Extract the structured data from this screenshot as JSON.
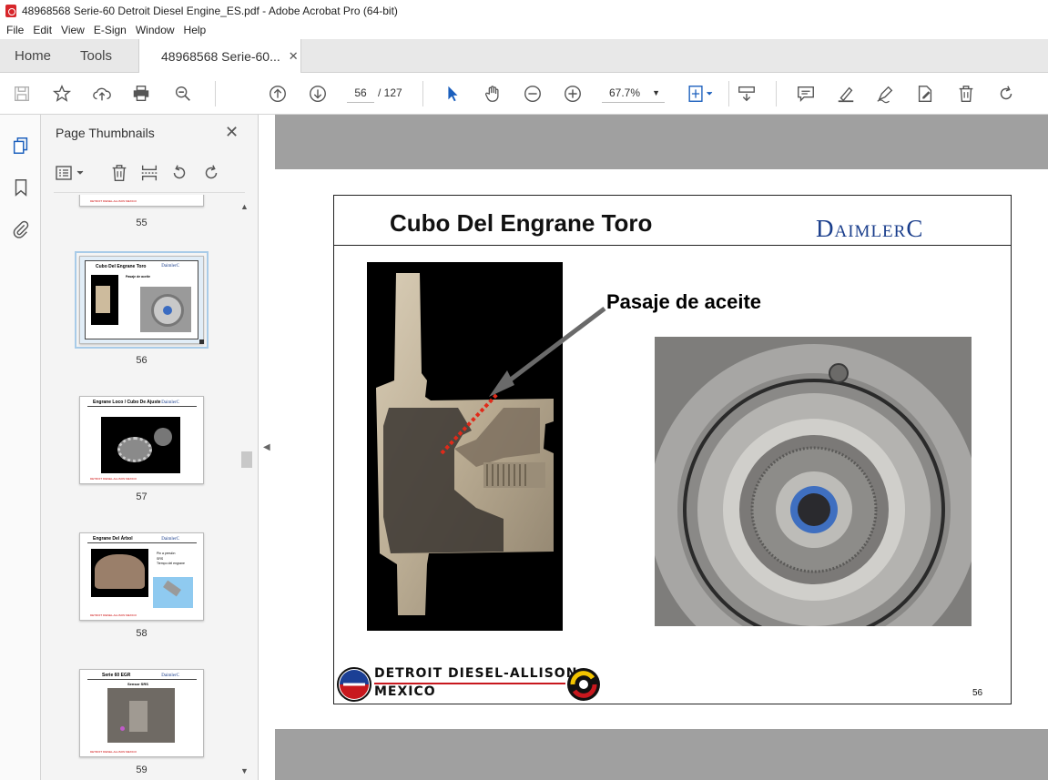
{
  "window": {
    "title": "48968568 Serie-60 Detroit Diesel Engine_ES.pdf - Adobe Acrobat Pro (64-bit)"
  },
  "menu": [
    "File",
    "Edit",
    "View",
    "E-Sign",
    "Window",
    "Help"
  ],
  "tabs": {
    "home": "Home",
    "tools": "Tools",
    "document": "48968568 Serie-60...",
    "close": "✕"
  },
  "toolbar": {
    "current_page": "56",
    "page_of": "/  127",
    "zoom": "67.7%"
  },
  "thumbnails_panel": {
    "title": "Page Thumbnails",
    "close": "✕",
    "pages": [
      {
        "number": "55",
        "title": "",
        "selected": false
      },
      {
        "number": "56",
        "title": "Cubo Del Engrane Toro",
        "selected": true
      },
      {
        "number": "57",
        "title": "Engrane Loco / Cubo De Ajuste",
        "selected": false
      },
      {
        "number": "58",
        "title": "Engrane Del Árbol",
        "selected": false
      },
      {
        "number": "59",
        "title": "Serie 60 EGR",
        "selected": false
      }
    ],
    "thumb_texts": {
      "logo": "DaimlerC",
      "p56_label": "Pasaje de aceite",
      "p58_b1": "Pin a presión",
      "p58_b2": "SRS",
      "p58_b3": "Tiempo del engrane",
      "p59_sub": "Sensor SRS",
      "footer": "DETROIT DIESEL-ALLISON MEXICO"
    }
  },
  "slide": {
    "title": "Cubo Del Engrane Toro",
    "brand": "DaimlerC",
    "annotation": "Pasaje de aceite",
    "footer_line1": "DETROIT DIESEL-ALLISON",
    "footer_line2": "MEXICO",
    "page_number": "56"
  },
  "colors": {
    "accent_blue": "#1a3e8c",
    "footer_red": "#c8181e",
    "doc_background": "#a0a0a0"
  }
}
